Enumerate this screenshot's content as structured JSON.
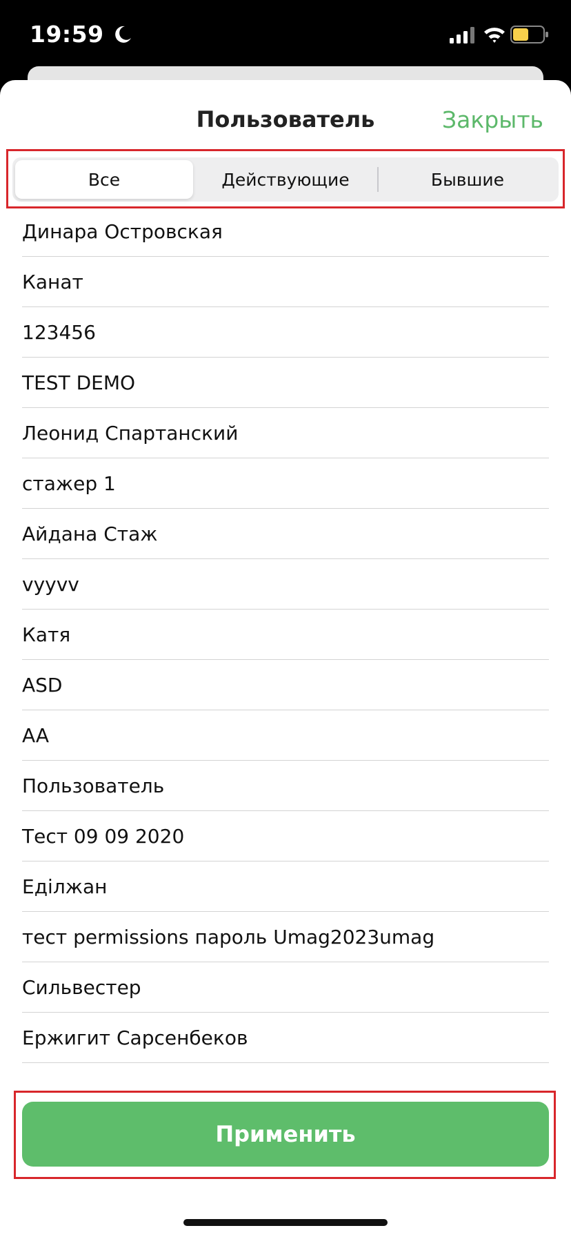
{
  "status_bar": {
    "time": "19:59",
    "icons": [
      "moon-icon",
      "signal-icon",
      "wifi-icon",
      "battery-icon"
    ],
    "battery_color": "#f7d04b"
  },
  "header": {
    "title": "Пользователь",
    "close_label": "Закрыть"
  },
  "segments": [
    {
      "label": "Все",
      "selected": true
    },
    {
      "label": "Действующие",
      "selected": false
    },
    {
      "label": "Бывшие",
      "selected": false
    }
  ],
  "users": [
    "Динара Островская",
    "Канат",
    "123456",
    "TEST DEMO",
    "Леонид Спартанский",
    "стажер 1",
    "Айдана Стаж",
    "vyyvv",
    "Катя",
    "ASD",
    "AA",
    "Пользователь",
    "Тест 09 09 2020",
    "Еділжан",
    "тест permissions пароль Umag2023umag",
    "Сильвестер",
    "Ержигит Сарсенбеков"
  ],
  "apply_label": "Применить",
  "colors": {
    "accent": "#5ebd6b",
    "highlight": "#d8262b"
  }
}
